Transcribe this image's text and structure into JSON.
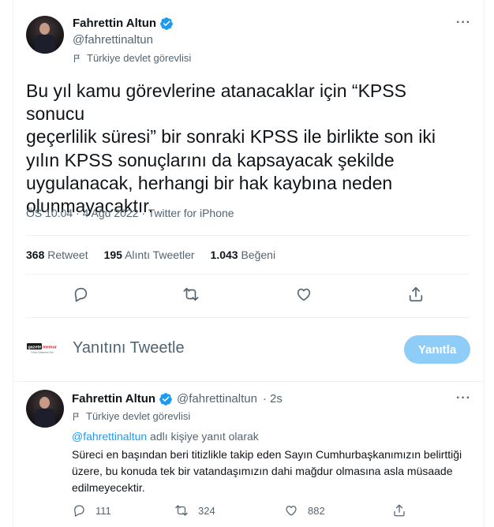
{
  "main_tweet": {
    "author_name": "Fahrettin Altun",
    "handle": "@fahrettinaltun",
    "label": "Türkiye devlet görevlisi",
    "text": "Bu yıl kamu görevlerine atanacaklar için “KPSS sonucu\ngeçerlilik süresi” bir sonraki KPSS ile birlikte son iki\nyılın KPSS sonuçlarını da kapsayacak şekilde\nuygulanacak, herhangi bir hak kaybına neden\nolunmayacaktır.",
    "meta": "ÖS 10:04 · 4 Ağu 2022 · Twitter for iPhone",
    "stats": {
      "retweets": "368",
      "retweets_label": "Retweet",
      "quotes": "195",
      "quotes_label": "Alıntı Tweetler",
      "likes": "1.043",
      "likes_label": "Beğeni"
    },
    "more_icon": "more-horizontal-icon"
  },
  "compose": {
    "logo_text": "gazete memur",
    "logo_tagline": "Türkiye Çalışanların Sesi",
    "placeholder": "Yanıtını Tweetle",
    "button_label": "Yanıtla"
  },
  "reply_tweet": {
    "author_name": "Fahrettin Altun",
    "handle": "@fahrettinaltun",
    "separator": "·",
    "time": "2s",
    "label": "Türkiye devlet görevlisi",
    "reply_to_mention": "@fahrettinaltun",
    "reply_to_suffix": " adlı kişiye yanıt olarak",
    "text": "Süreci en başından beri titizlikle takip eden Sayın Cumhurbaşkanımızın belirttiği üzere, bu konuda tek bir vatandaşımızın dahi mağdur olmasına asla müsaade edilmeyecektir.",
    "replies": "111",
    "retweets": "324",
    "likes": "882"
  },
  "colors": {
    "accent": "#1d9bf0",
    "button_disabled": "#8ecdf8",
    "secondary_text": "#536471",
    "divider": "#eff3f4"
  }
}
